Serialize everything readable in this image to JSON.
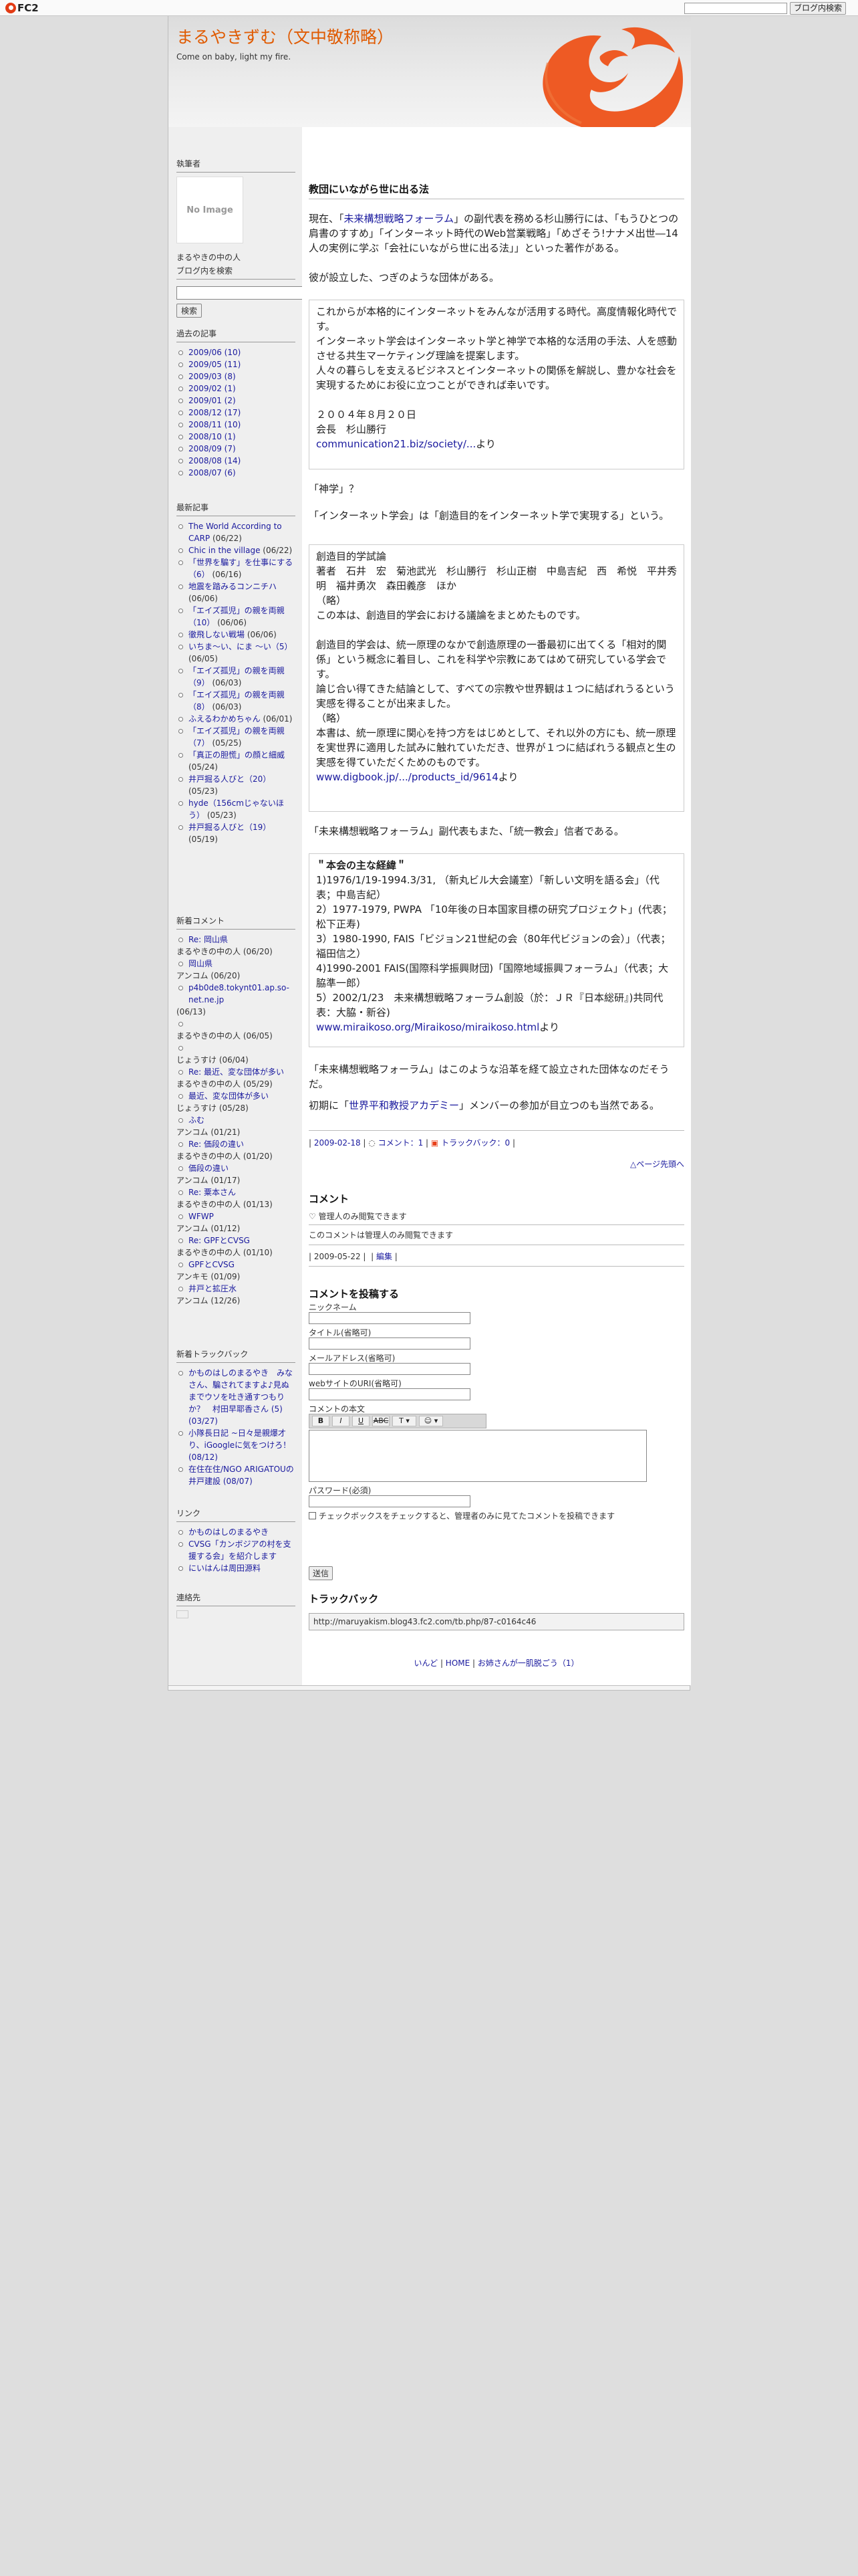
{
  "topbar": {
    "logo_text": "FC2",
    "search_button": "ブログ内検索",
    "search_value": ""
  },
  "header": {
    "title": "まるやきずむ（文中敬称略）",
    "description": "Come on baby, light my fire."
  },
  "sidebar": {
    "profile": {
      "heading": "執筆者",
      "noimage": "No Image",
      "name": "まるやきの中の人"
    },
    "search": {
      "heading": "ブログ内を検索",
      "button": "検索"
    },
    "archives": {
      "heading": "過去の記事",
      "items": [
        {
          "label": "2009/06 (10)"
        },
        {
          "label": "2009/05 (11)"
        },
        {
          "label": "2009/03 (8)"
        },
        {
          "label": "2009/02 (1)"
        },
        {
          "label": "2009/01 (2)"
        },
        {
          "label": "2008/12 (17)"
        },
        {
          "label": "2008/11 (10)"
        },
        {
          "label": "2008/10 (1)"
        },
        {
          "label": "2008/09 (7)"
        },
        {
          "label": "2008/08 (14)"
        },
        {
          "label": "2008/07 (6)"
        }
      ]
    },
    "recent": {
      "heading": "最新記事",
      "items": [
        {
          "title": "The World According to CARP",
          "date": "(06/22)"
        },
        {
          "title": "Chic in the village",
          "date": "(06/22)"
        },
        {
          "title": "「世界を騙す」を仕事にする（6）",
          "date": "(06/16)"
        },
        {
          "title": "地震を踏みるコンニチハ",
          "date": "(06/06)"
        },
        {
          "title": "「エイズ孤児」の親を両親（10）",
          "date": "(06/06)"
        },
        {
          "title": "徹飛しない戦場",
          "date": "(06/06)"
        },
        {
          "title": "いちま〜い、にま 〜い（5）",
          "date": "(06/05)"
        },
        {
          "title": "「エイズ孤児」の親を両親（9）",
          "date": "(06/03)"
        },
        {
          "title": "「エイズ孤児」の親を両親（8）",
          "date": "(06/03)"
        },
        {
          "title": "ふえるわかめちゃん",
          "date": "(06/01)"
        },
        {
          "title": "「エイズ孤児」の親を両親（7）",
          "date": "(05/25)"
        },
        {
          "title": "「真正の胆慌」の顔と細威",
          "date": "(05/24)"
        },
        {
          "title": "井戸掘る人びと（20）",
          "date": "(05/23)"
        },
        {
          "title": "hyde（156cmじゃないほう）",
          "date": "(05/23)"
        },
        {
          "title": "井戸掘る人びと（19）",
          "date": "(05/19)"
        }
      ]
    },
    "comments": {
      "heading": "新着コメント",
      "items": [
        {
          "title": "Re: 岡山県",
          "by": "まるやきの中の人",
          "date": "(06/20)"
        },
        {
          "title": "岡山県",
          "by": "アンコム",
          "date": "(06/20)"
        },
        {
          "title": "p4b0de8.tokynt01.ap.so-net.ne.jp",
          "by": "",
          "date": "(06/13)"
        },
        {
          "title": "",
          "by": "まるやきの中の人",
          "date": "(06/05)"
        },
        {
          "title": "",
          "by": "じょうすけ",
          "date": "(06/04)"
        },
        {
          "title": "Re: 最近、変な団体が多い",
          "by": "まるやきの中の人",
          "date": "(05/29)"
        },
        {
          "title": "最近、変な団体が多い",
          "by": "じょうすけ",
          "date": "(05/28)"
        },
        {
          "title": "ふむ",
          "by": "アンコム",
          "date": "(01/21)"
        },
        {
          "title": "Re: 価段の違い",
          "by": "まるやきの中の人",
          "date": "(01/20)"
        },
        {
          "title": "価段の違い",
          "by": "アンコム",
          "date": "(01/17)"
        },
        {
          "title": "Re: 粟本さん",
          "by": "まるやきの中の人",
          "date": "(01/13)"
        },
        {
          "title": "WFWP",
          "by": "アンコム",
          "date": "(01/12)"
        },
        {
          "title": "Re: GPFとCVSG",
          "by": "まるやきの中の人",
          "date": "(01/10)"
        },
        {
          "title": "GPFとCVSG",
          "by": "アンキモ",
          "date": "(01/09)"
        },
        {
          "title": "井戸と拡圧水",
          "by": "アンコム",
          "date": "(12/26)"
        }
      ]
    },
    "trackbacks": {
      "heading": "新着トラックバック",
      "items": [
        {
          "label": "かものはしのまるやき　みなさん、騙されてますよ♪見ぬまでウソを吐き通すつもりか？　村田早耶香さん (5) (03/27)"
        },
        {
          "label": "小隊長日記 ~日々是親爆才り、iGoogleに気をつけろ！ (08/12)"
        },
        {
          "label": "在住在住/NGO ARIGATOUの井戸建設 (08/07)"
        }
      ]
    },
    "links": {
      "heading": "リンク",
      "items": [
        {
          "label": "かものはしのまるやき"
        },
        {
          "label": "CVSG「カンボジアの村を支援する会」を紹介します"
        },
        {
          "label": "にいはんは周田源料"
        }
      ]
    },
    "contact": {
      "heading": "連絡先"
    }
  },
  "post": {
    "title": "教団にいながら世に出る法",
    "p1_pre": "現在、「",
    "p1_link": "未来構想戦略フォーラム",
    "p1_post": "」の副代表を務める杉山勝行には、「もうひとつの肩書のすすめ」「インターネット時代のWeb営業戦略」「めざそう!ナナメ出世―14人の実例に学ぶ「会社にいながら世に出る法」」といった著作がある。",
    "p2": "彼が設立した、つぎのような団体がある。",
    "bq1_text": "これからが本格的にインターネットをみんなが活用する時代。高度情報化時代です。\nインターネット学会はインターネット学と神学で本格的な活用の手法、人を感動させる共生マーケティング理論を提案します。\n人々の暮らしを支えるビジネスとインターネットの関係を解説し、豊かな社会を実現するためにお役に立つことができれば幸いです。\n\n２００４年８月２０日\n会長　杉山勝行",
    "bq1_link": "communication21.biz/society/...",
    "bq1_suffix": "より",
    "p3": "「神学」？",
    "p4": "「インターネット学会」は「創造目的をインターネット学で実現する」という。",
    "bq2_text": "創造目的学試論\n著者　石井　宏　菊池武光　杉山勝行　杉山正樹　中島吉紀　西　希悦　平井秀明　福井勇次　森田義彦　ほか\n（略）\nこの本は、創造目的学会における議論をまとめたものです。\n\n創造目的学会は、統一原理のなかで創造原理の一番最初に出てくる「相対的関係」という概念に着目し、これを科学や宗教にあてはめて研究している学会です。\n論じ合い得てきた結論として、すべての宗教や世界観は１つに結ばれうるという実感を得ることが出来ました。\n（略）\n本書は、統一原理に関心を持つ方をはじめとして、それ以外の方にも、統一原理を実世界に適用した試みに触れていただき、世界が１つに結ばれうる観点と生の実感を得ていただくためのものです。",
    "bq2_link": "www.digbook.jp/.../products_id/9614",
    "bq2_suffix": "より",
    "p5": "「未来構想戦略フォーラム」副代表もまた、「統一教会」信者である。",
    "bq3_heading": "＂本会の主な経緯＂",
    "bq3_text": "1)1976/1/19-1994.3/31, （新丸ビル大会議室）「新しい文明を語る会」（代表；中島吉紀）\n2）1977-1979, PWPA 「10年後の日本国家目標の研究プロジェクト」(代表；松下正寿)\n3）1980-1990, FAIS「ビジョン21世紀の会（80年代ビジョンの会）」（代表；福田信之）\n4)1990-2001 FAIS(国際科学振興財団)「国際地域振興フォーラム」（代表；大脇準一郎）\n5）2002/1/23　未来構想戦略フォーラム創設（於：ＪＲ『日本総研』)共同代表：大脇・新谷)",
    "bq3_link": "www.miraikoso.org/Miraikoso/miraikoso.html",
    "bq3_suffix": "より",
    "p6": "「未来構想戦略フォーラム」はこのような沿革を経て設立された団体なのだそうだ。",
    "p7_pre": "初期に「",
    "p7_link": "世界平和教授アカデミー",
    "p7_post": "」メンバーの参加が目立つのも当然である。",
    "meta_date": "2009-02-18",
    "meta_comment": "コメント：1",
    "meta_tb": "トラックバック：0",
    "pagetop": "△ページ先頭へ"
  },
  "comments": {
    "heading": "コメント",
    "item_title": "管理人のみ閲覧できます",
    "item_body": "このコメントは管理人のみ閲覧できます",
    "item_date": "2009-05-22",
    "item_edit": "編集"
  },
  "form": {
    "heading": "コメントを投稿する",
    "name_label": "ニックネーム",
    "title_label": "タイトル(省略可)",
    "mail_label": "メールアドレス(省略可)",
    "url_label": "webサイトのURI(省略可)",
    "body_label": "コメントの本文",
    "toolbar": [
      "B",
      "I",
      "U",
      "ABC",
      "T ▾",
      "☺ ▾"
    ],
    "pass_label": "パスワード(必須)",
    "secret_label": "チェックボックスをチェックすると、管理者のみに見てたコメントを投稿できます",
    "submit": "送信"
  },
  "trackback": {
    "heading": "トラックバック",
    "url": "http://maruyakism.blog43.fc2.com/tb.php/87-c0164c46"
  },
  "nav": {
    "prev": "いんど",
    "home": "HOME",
    "next": "お姉さんが一肌脱ごう（1）"
  },
  "colors": {
    "title": "#e05a00",
    "link": "#1a1a9e",
    "flame": "#e8401a"
  }
}
